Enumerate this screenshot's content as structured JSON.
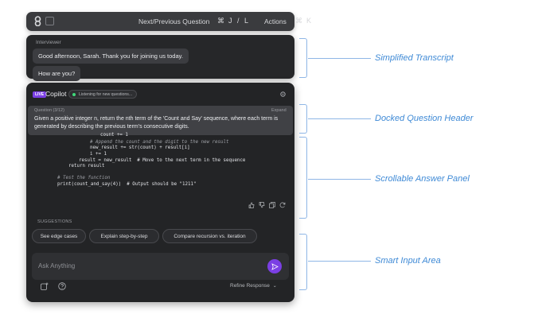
{
  "topbar": {
    "nav_label": "Next/Previous Question",
    "nav_shortcut_cmd": "⌘",
    "nav_shortcut_keys": "J / L",
    "actions_label": "Actions",
    "actions_shortcut_cmd": "⌘",
    "actions_shortcut_key": "K"
  },
  "transcript": {
    "role": "Interviewer",
    "messages": [
      "Good afternoon, Sarah. Thank you for joining us today.",
      "How are you?"
    ]
  },
  "copilot": {
    "badge": "LIVE",
    "title": "Copilot",
    "status": "Listening for new questions..."
  },
  "question": {
    "label": "Question (3/12)",
    "expand": "Expand",
    "text": "Given a positive integer n, return the nth term of the 'Count and Say' sequence, where each term is generated by describing the previous term's consecutive digits."
  },
  "code": {
    "lines": [
      "count += 1",
      "# Append the count and the digit to the new result",
      "new_result += str(count) + result[i]",
      "i += 1",
      "result = new_result  # Move to the next term in the sequence",
      "return result",
      "# Test the function",
      "print(count_and_say(4))  # Output should be \"1211\""
    ]
  },
  "suggestions": {
    "label": "SUGGESTIONS",
    "items": [
      "See edge cases",
      "Explain step-by-step",
      "Compare recursion vs. iteration"
    ]
  },
  "input": {
    "placeholder": "Ask Anything",
    "refine_label": "Refine Response"
  },
  "annotations": [
    "Simplified Transcript",
    "Docked Question Header",
    "Scrollable Answer Panel",
    "Smart Input Area"
  ],
  "colors": {
    "accent": "#7b3fe4",
    "annotation": "#3f8ad6",
    "listening_dot": "#3fd97a"
  }
}
